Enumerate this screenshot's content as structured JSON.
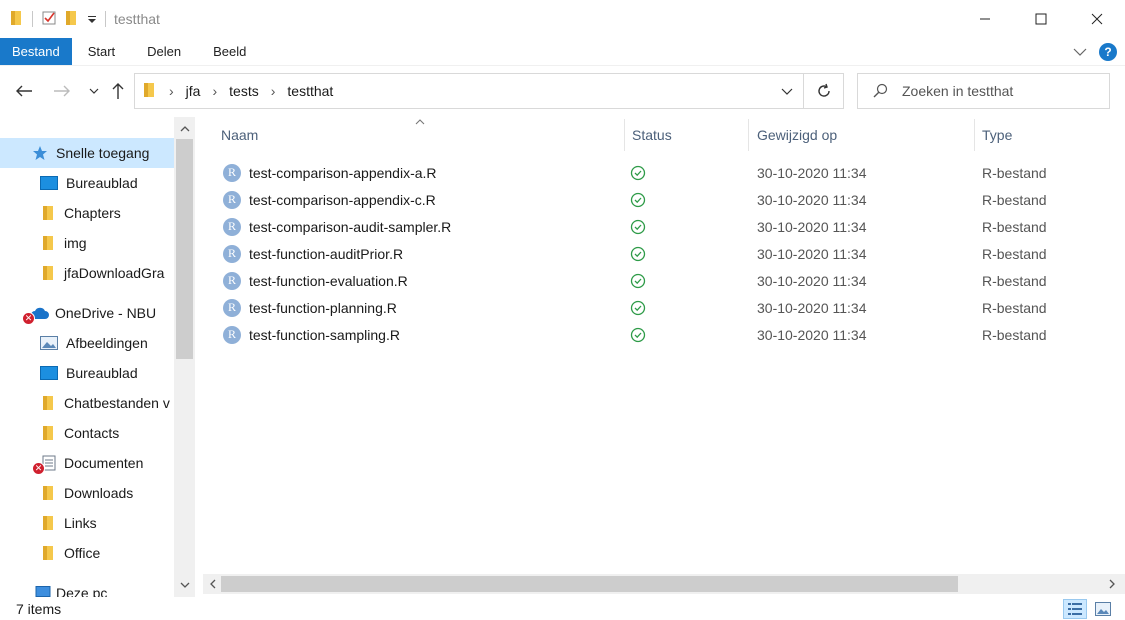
{
  "window": {
    "title": "testthat"
  },
  "ribbon": {
    "tabs": [
      {
        "label": "Bestand",
        "active": true
      },
      {
        "label": "Start",
        "active": false
      },
      {
        "label": "Delen",
        "active": false
      },
      {
        "label": "Beeld",
        "active": false
      }
    ]
  },
  "address": {
    "segments": [
      "jfa",
      "tests",
      "testthat"
    ]
  },
  "search": {
    "placeholder": "Zoeken in testthat"
  },
  "sidebar": {
    "items": [
      {
        "label": "Snelle toegang",
        "icon": "star-icon",
        "selected": true
      },
      {
        "label": "Bureaublad",
        "icon": "desktop-icon"
      },
      {
        "label": "Chapters",
        "icon": "folder-icon"
      },
      {
        "label": "img",
        "icon": "folder-icon"
      },
      {
        "label": "jfaDownloadGra",
        "icon": "folder-icon"
      },
      {
        "label": "OneDrive - NBU",
        "icon": "cloud-icon",
        "error": true
      },
      {
        "label": "Afbeeldingen",
        "icon": "pictures-icon"
      },
      {
        "label": "Bureaublad",
        "icon": "desktop-icon"
      },
      {
        "label": "Chatbestanden v",
        "icon": "folder-icon"
      },
      {
        "label": "Contacts",
        "icon": "folder-icon"
      },
      {
        "label": "Documenten",
        "icon": "document-icon",
        "error": true
      },
      {
        "label": "Downloads",
        "icon": "folder-icon"
      },
      {
        "label": "Links",
        "icon": "folder-icon"
      },
      {
        "label": "Office",
        "icon": "folder-icon"
      },
      {
        "label": "Deze pc",
        "icon": "pc-icon"
      }
    ]
  },
  "list": {
    "columns": {
      "name": "Naam",
      "status": "Status",
      "modified": "Gewijzigd op",
      "type": "Type"
    },
    "rows": [
      {
        "name": "test-comparison-appendix-a.R",
        "modified": "30-10-2020 11:34",
        "type": "R-bestand"
      },
      {
        "name": "test-comparison-appendix-c.R",
        "modified": "30-10-2020 11:34",
        "type": "R-bestand"
      },
      {
        "name": "test-comparison-audit-sampler.R",
        "modified": "30-10-2020 11:34",
        "type": "R-bestand"
      },
      {
        "name": "test-function-auditPrior.R",
        "modified": "30-10-2020 11:34",
        "type": "R-bestand"
      },
      {
        "name": "test-function-evaluation.R",
        "modified": "30-10-2020 11:34",
        "type": "R-bestand"
      },
      {
        "name": "test-function-planning.R",
        "modified": "30-10-2020 11:34",
        "type": "R-bestand"
      },
      {
        "name": "test-function-sampling.R",
        "modified": "30-10-2020 11:34",
        "type": "R-bestand"
      }
    ],
    "file_icon_letter": "R"
  },
  "statusbar": {
    "count": "7 items"
  },
  "colors": {
    "accent": "#1979ca",
    "selected": "#cce8ff",
    "status_ok": "#2e9b48",
    "folder": "#f5c84c"
  }
}
